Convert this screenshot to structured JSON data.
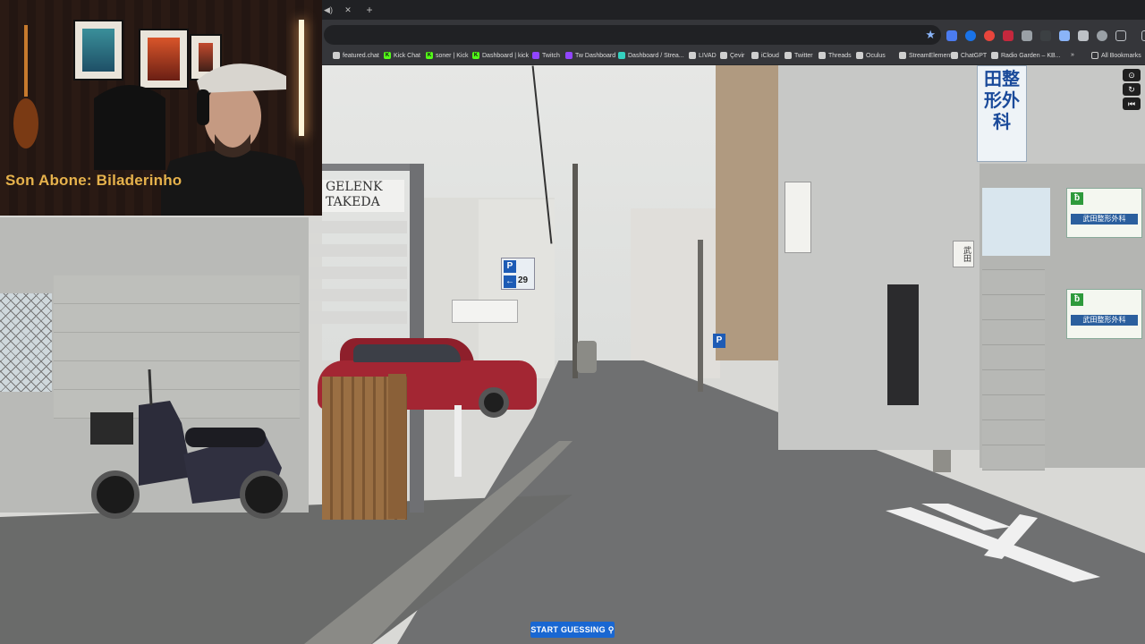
{
  "browser": {
    "tab": {
      "title": ""
    },
    "new_tab_label": "+",
    "bookmarks": [
      {
        "label": "featured.chat",
        "color": "#cfcfcf",
        "glyph": ""
      },
      {
        "label": "Kick Chat",
        "color": "#53fc18",
        "glyph": "K"
      },
      {
        "label": "soner | Kick",
        "color": "#53fc18",
        "glyph": "K"
      },
      {
        "label": "Dashboard | kick",
        "color": "#53fc18",
        "glyph": "K"
      },
      {
        "label": "Twitch",
        "color": "#9146ff",
        "glyph": ""
      },
      {
        "label": "Tw Dashboard",
        "color": "#9146ff",
        "glyph": ""
      },
      {
        "label": "Dashboard / Strea...",
        "color": "#34d1bf",
        "glyph": ""
      },
      {
        "label": "LIVAD",
        "color": "#cfcfcf",
        "glyph": ""
      },
      {
        "label": "Çevir",
        "color": "#cfcfcf",
        "glyph": ""
      },
      {
        "label": "iCloud",
        "color": "#cfcfcf",
        "glyph": ""
      },
      {
        "label": "Twitter",
        "color": "#cfcfcf",
        "glyph": ""
      },
      {
        "label": "Threads",
        "color": "#cfcfcf",
        "glyph": ""
      },
      {
        "label": "Oculus",
        "color": "#cfcfcf",
        "glyph": ""
      },
      {
        "label": "StreamElements",
        "color": "#cfcfcf",
        "glyph": ""
      },
      {
        "label": "ChatGPT",
        "color": "#cfcfcf",
        "glyph": ""
      },
      {
        "label": "Radio Garden – KB...",
        "color": "#cfcfcf",
        "glyph": ""
      }
    ],
    "more_bookmarks": "»",
    "all_bookmarks": "All Bookmarks"
  },
  "webcam": {
    "caption": "Son Abone: Biladerinho"
  },
  "street_signs": {
    "gelenk": "GELENK\nTAKEDA",
    "clinic_vertical": "田整形外科",
    "takeda_label": "武田整形外科",
    "parking_number": "29",
    "parking_p": "P",
    "side_panel": "武田"
  },
  "game": {
    "start_button": "START GUESSING",
    "controls": [
      {
        "name": "compass-button",
        "glyph": "⊙"
      },
      {
        "name": "return-button",
        "glyph": "↻"
      },
      {
        "name": "undo-button",
        "glyph": "⏮"
      }
    ]
  },
  "colors": {
    "accent": "#1967d2",
    "caption": "#e6b24c",
    "car": "#a32633"
  }
}
